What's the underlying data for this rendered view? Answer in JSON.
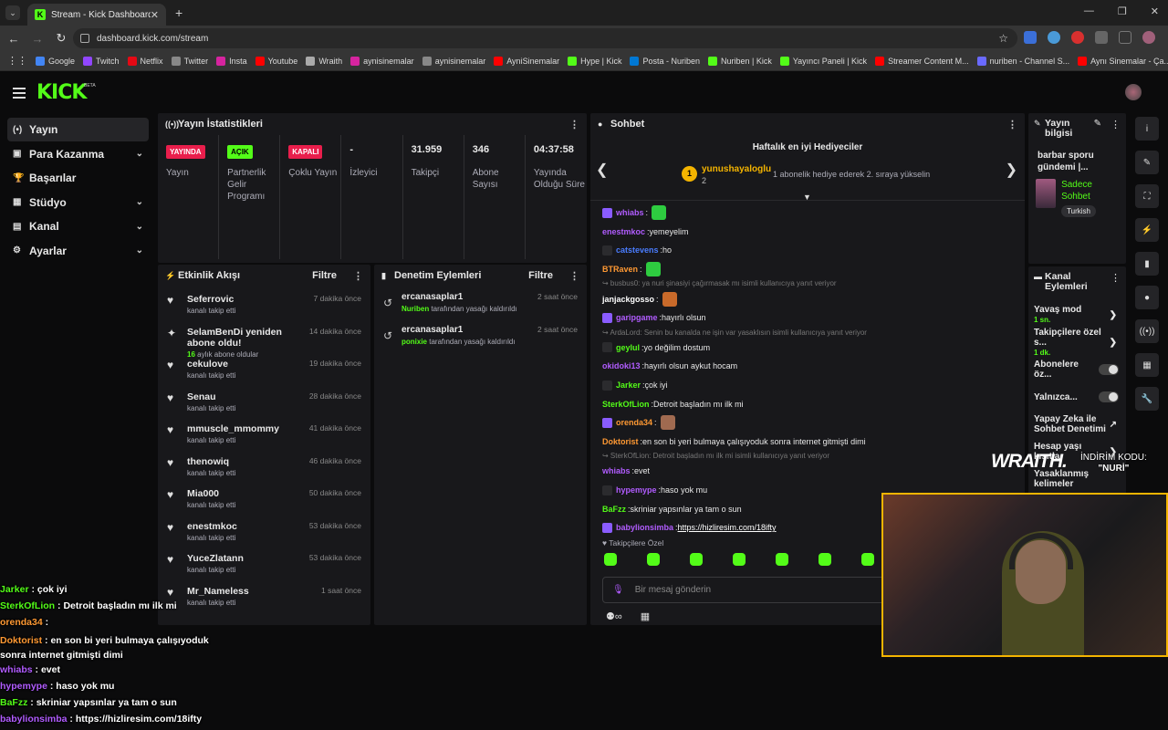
{
  "browser": {
    "tab_title": "Stream - Kick Dashboard",
    "url": "dashboard.kick.com/stream",
    "bookmarks": [
      {
        "label": "Google",
        "color": "#4285f4"
      },
      {
        "label": "Twitch",
        "color": "#9146ff"
      },
      {
        "label": "Netflix",
        "color": "#e50914"
      },
      {
        "label": "Twitter",
        "color": "#888888"
      },
      {
        "label": "Insta",
        "color": "#d6249f"
      },
      {
        "label": "Youtube",
        "color": "#ff0000"
      },
      {
        "label": "Wraith",
        "color": "#aaaaaa"
      },
      {
        "label": "aynisinemalar",
        "color": "#d6249f"
      },
      {
        "label": "aynisinemalar",
        "color": "#888888"
      },
      {
        "label": "AyniSinemalar",
        "color": "#ff0000"
      },
      {
        "label": "Hype | Kick",
        "color": "#53fc18"
      },
      {
        "label": "Posta - Nuriben",
        "color": "#0078d4"
      },
      {
        "label": "Nuriben | Kick",
        "color": "#53fc18"
      },
      {
        "label": "Yayıncı Paneli | Kick",
        "color": "#53fc18"
      },
      {
        "label": "Streamer Content M...",
        "color": "#ff0000"
      },
      {
        "label": "nuriben - Channel S...",
        "color": "#6a6aff"
      },
      {
        "label": "Aynı Sinemalar - Ça...",
        "color": "#ff0000"
      }
    ]
  },
  "app": {
    "logo": "KICK",
    "beta": "BETA"
  },
  "sidebar": [
    {
      "label": "Yayın",
      "icon": "(•)",
      "active": true,
      "chev": ""
    },
    {
      "label": "Para Kazanma",
      "icon": "▣",
      "chev": "⌄"
    },
    {
      "label": "Başarılar",
      "icon": "🏆",
      "chev": ""
    },
    {
      "label": "Stüdyo",
      "icon": "▦",
      "chev": "⌄"
    },
    {
      "label": "Kanal",
      "icon": "▤",
      "chev": "⌄"
    },
    {
      "label": "Ayarlar",
      "icon": "⚙",
      "chev": "⌄"
    }
  ],
  "stats": {
    "title": "Yayın İstatistikleri",
    "items": [
      {
        "badge": "YAYINDA",
        "badge_color": "red",
        "label": "Yayın"
      },
      {
        "badge": "AÇIK",
        "badge_color": "green",
        "label": "Partnerlik Gelir Programı"
      },
      {
        "badge": "KAPALI",
        "badge_color": "red",
        "label": "Çoklu Yayın"
      },
      {
        "value": "-",
        "label": "İzleyici"
      },
      {
        "value": "31.959",
        "label": "Takipçi"
      },
      {
        "value": "346",
        "label": "Abone Sayısı"
      },
      {
        "value": "04:37:58",
        "label": "Yayında Olduğu Süre"
      }
    ]
  },
  "activity": {
    "title": "Etkinlik Akışı",
    "filter": "Filtre",
    "items": [
      {
        "name": "Seferrovic",
        "sub": "kanalı takip etti",
        "time": "7 dakika önce",
        "icon": "♥"
      },
      {
        "name": "SelamBenDi yeniden abone oldu!",
        "sub_hl": "16",
        "sub": " aylık abone oldular",
        "time": "14 dakika önce",
        "icon": "✦"
      },
      {
        "name": "cekulove",
        "sub": "kanalı takip etti",
        "time": "19 dakika önce",
        "icon": "♥"
      },
      {
        "name": "Senau",
        "sub": "kanalı takip etti",
        "time": "28 dakika önce",
        "icon": "♥"
      },
      {
        "name": "mmuscle_mmommy",
        "sub": "kanalı takip etti",
        "time": "41 dakika önce",
        "icon": "♥"
      },
      {
        "name": "thenowiq",
        "sub": "kanalı takip etti",
        "time": "46 dakika önce",
        "icon": "♥"
      },
      {
        "name": "Mia000",
        "sub": "kanalı takip etti",
        "time": "50 dakika önce",
        "icon": "♥"
      },
      {
        "name": "enestmkoc",
        "sub": "kanalı takip etti",
        "time": "53 dakika önce",
        "icon": "♥"
      },
      {
        "name": "YuceZlatann",
        "sub": "kanalı takip etti",
        "time": "53 dakika önce",
        "icon": "♥"
      },
      {
        "name": "Mr_Nameless",
        "sub": "kanalı takip etti",
        "time": "1 saat önce",
        "icon": "♥"
      }
    ]
  },
  "moderation": {
    "title": "Denetim Eylemleri",
    "filter": "Filtre",
    "items": [
      {
        "name": "ercanasaplar1",
        "actor": "Nuriben",
        "action": " tarafından yasağı kaldırıldı",
        "time": "2 saat önce"
      },
      {
        "name": "ercanasaplar1",
        "actor": "ponixie",
        "action": " tarafından yasağı kaldırıldı",
        "time": "2 saat önce"
      }
    ]
  },
  "chat": {
    "title": "Sohbet",
    "gifters_title": "Haftalık en iyi Hediyeciler",
    "top_gifter": "yunushayaloglu",
    "top_rank": "1",
    "top_count": "2",
    "gifter_info": "1 abonelik hediye ederek 2. sıraya yükselin",
    "messages": [
      {
        "user": "whiabs",
        "color": "#b15cff",
        "text": "",
        "emote": "#2ecc40"
      },
      {
        "user": "enestmkoc",
        "color": "#b15cff",
        "text": "yemeyelim"
      },
      {
        "user": "catstevens",
        "color": "#4a7dff",
        "text": "ho"
      },
      {
        "user": "BTRaven",
        "color": "#ff9933",
        "text": "",
        "emote": "#2ecc40"
      },
      {
        "reply": "↪ busbus0: ya nuri şinasiyi çağırmasak mı isimli kullanıcıya yanıt veriyor"
      },
      {
        "user": "janjackgosso",
        "color": "#ffffff",
        "text": "",
        "emote": "#c96a2a"
      },
      {
        "user": "garipgame",
        "color": "#b15cff",
        "text": "hayırlı olsun"
      },
      {
        "reply": "↪ ArdaLord: Senin bu kanalda ne işin var yasaklısın isimli kullanıcıya yanıt veriyor"
      },
      {
        "user": "geylul",
        "color": "#53fc18",
        "text": "yo değilim dostum"
      },
      {
        "user": "okidoki13",
        "color": "#b15cff",
        "text": "hayırlı olsun aykut hocam"
      },
      {
        "user": "Jarker",
        "color": "#53fc18",
        "text": "çok iyi"
      },
      {
        "user": "SterkOfLion",
        "color": "#53fc18",
        "text": "Detroit başladın mı ilk mi"
      },
      {
        "user": "orenda34",
        "color": "#ff9933",
        "text": "",
        "emote": "#a06a50"
      },
      {
        "user": "Doktorist",
        "color": "#ff9933",
        "text": "en son bi yeri bulmaya çalışıyoduk sonra internet gitmişti dimi"
      },
      {
        "reply": "↪ SterkOfLion: Detroit başladın mı ilk mi isimli kullanıcıya yanıt veriyor"
      },
      {
        "user": "whiabs",
        "color": "#b15cff",
        "text": "evet"
      },
      {
        "user": "hypemype",
        "color": "#b15cff",
        "text": "haso yok mu"
      },
      {
        "user": "BaFzz",
        "color": "#53fc18",
        "text": "skriniar yapsınlar ya tam o sun"
      },
      {
        "user": "babylionsimba",
        "color": "#b15cff",
        "link": "https://hizliresim.com/18ifty"
      }
    ],
    "followers_only": "Takipçilere Özel",
    "input_placeholder": "Bir mesaj gönderin"
  },
  "stream_info": {
    "title": "Yayın bilgisi",
    "stream_title": "barbar sporu gündemi |...",
    "mode": "Sadece Sohbet",
    "lang": "Turkish"
  },
  "channel_actions": {
    "title": "Kanal Eylemleri",
    "items": [
      {
        "label": "Yavaş mod",
        "sub": "1 sn.",
        "ctl": "chev"
      },
      {
        "label": "Takipçilere özel s...",
        "sub": "1 dk.",
        "ctl": "chev"
      },
      {
        "label": "Abonelere öz...",
        "ctl": "toggle"
      },
      {
        "label": "Yalnızca...",
        "ctl": "toggle"
      },
      {
        "label": "Yapay Zeka ile Sohbet Denetimi",
        "ctl": "ext"
      },
      {
        "label": "Hesap yaşı kısıtla",
        "ctl": "chev"
      },
      {
        "label": "Yasaklanmış kelimeler",
        "ctl": ""
      }
    ]
  },
  "overlay": {
    "messages": [
      {
        "user": "Jarker",
        "text": "çok iyi",
        "color": "#53fc18"
      },
      {
        "user": "SterkOfLion",
        "text": "Detroit başladın mı ilk mi",
        "color": "#53fc18"
      },
      {
        "user": "orenda34",
        "text": "",
        "color": "#ff9933"
      },
      {
        "user": "Doktorist",
        "text": "en son bi yeri bulmaya çalışıyoduk sonra internet gitmişti dimi",
        "color": "#ff9933"
      },
      {
        "user": "whiabs",
        "text": "evet",
        "color": "#b15cff"
      },
      {
        "user": "hypemype",
        "text": "haso yok mu",
        "color": "#b15cff"
      },
      {
        "user": "BaFzz",
        "text": "skriniar yapsınlar ya tam o sun",
        "color": "#53fc18"
      },
      {
        "user": "babylionsimba",
        "text": "https://hizliresim.com/18ifty",
        "color": "#b15cff"
      }
    ],
    "brand": "WRAITH.",
    "promo_line1": "İNDİRİM KODU:",
    "promo_line2": "\"NURİ\""
  }
}
